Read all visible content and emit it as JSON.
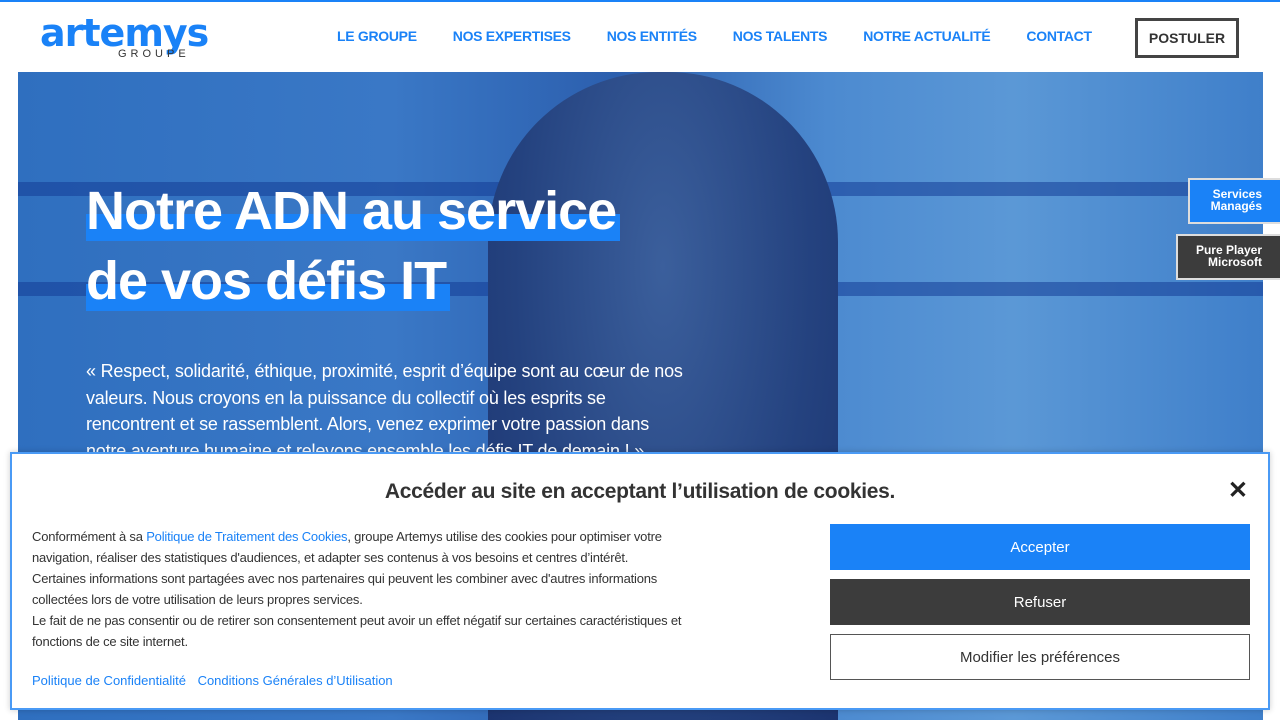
{
  "brand": {
    "name": "artemys",
    "sub": "GROUPE",
    "accent": "#1a82f7"
  },
  "nav": [
    "LE GROUPE",
    "NOS EXPERTISES",
    "NOS ENTITÉS",
    "NOS TALENTS",
    "NOTRE ACTUALITÉ",
    "CONTACT"
  ],
  "postuler": "POSTULER",
  "hero": {
    "line1": "Notre ADN au service",
    "line2": "de vos défis IT",
    "quote": "« Respect, solidarité, éthique, proximité, esprit d’équipe sont au cœur de nos valeurs. Nous croyons en la puissance du collectif où les esprits se rencontrent et se rassemblent. Alors, venez exprimer votre passion dans notre aventure humaine et relevons ensemble les défis IT de demain ! »"
  },
  "side": {
    "s1_a": "Services",
    "s1_b": "Managés",
    "s2_a": "Pure Player",
    "s2_b": "Microsoft"
  },
  "cookie": {
    "title": "Accéder au site en acceptant l’utilisation de cookies.",
    "t1": "Conformément à sa ",
    "link": "Politique de Traitement des Cookies",
    "t2": ", groupe Artemys utilise des cookies pour optimiser votre navigation, réaliser des statistiques d'audiences, et adapter ses contenus à vos besoins et centres d’intérêt. Certaines informations sont partagées avec nos partenaires qui peuvent les combiner avec d'autres informations collectées lors de votre utilisation de leurs propres services.",
    "t3": "Le fait de ne pas consentir ou de retirer son consentement peut avoir un effet négatif sur certaines caractéristiques et fonctions de ce site internet.",
    "privacy": "Politique de Confidentialité",
    "terms": "Conditions Générales d’Utilisation",
    "accept": "Accepter",
    "refuse": "Refuser",
    "prefs": "Modifier les préférences",
    "close": "✕"
  }
}
